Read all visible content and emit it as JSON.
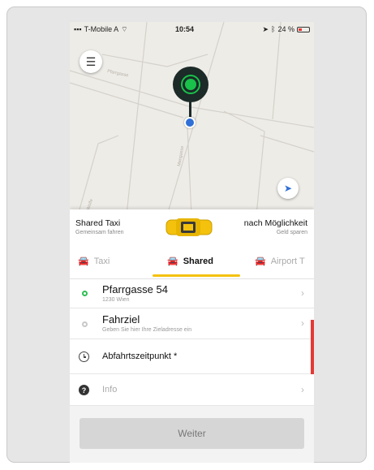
{
  "status_bar": {
    "carrier": "T-Mobile A",
    "time": "10:54",
    "battery": "24 %"
  },
  "map": {
    "street_1": "Pfarrgasse",
    "street_2": "Mangasse",
    "street_3": "Wolfe",
    "pin_color": "#1c2a28",
    "pin_accent": "#19c24a",
    "location_dot_color": "#2f6fd6"
  },
  "services": {
    "left_title": "Shared Taxi",
    "left_sub": "Gemeinsam fahren",
    "right_title": "nach Möglichkeit",
    "right_sub": "Geld sparen",
    "car_color": "#f4c20d"
  },
  "tabs": [
    {
      "label": "Taxi",
      "icon": "car-icon"
    },
    {
      "label": "Shared",
      "icon": "shared-car-icon"
    },
    {
      "label": "Airport T",
      "icon": "airport-car-icon"
    }
  ],
  "pickup": {
    "title": "Pfarrgasse 54",
    "sub": "1230 Wien"
  },
  "destination": {
    "title": "Fahrziel",
    "sub": "Geben Sie hier Ihre Zieladresse ein"
  },
  "departure": {
    "label": "Abfahrtszeitpunkt *"
  },
  "info": {
    "label": "Info"
  },
  "weiter_button": {
    "label": "Weiter"
  },
  "colors": {
    "accent_yellow": "#f4c20d",
    "error_red": "#e53935",
    "green": "#2fbf52"
  }
}
